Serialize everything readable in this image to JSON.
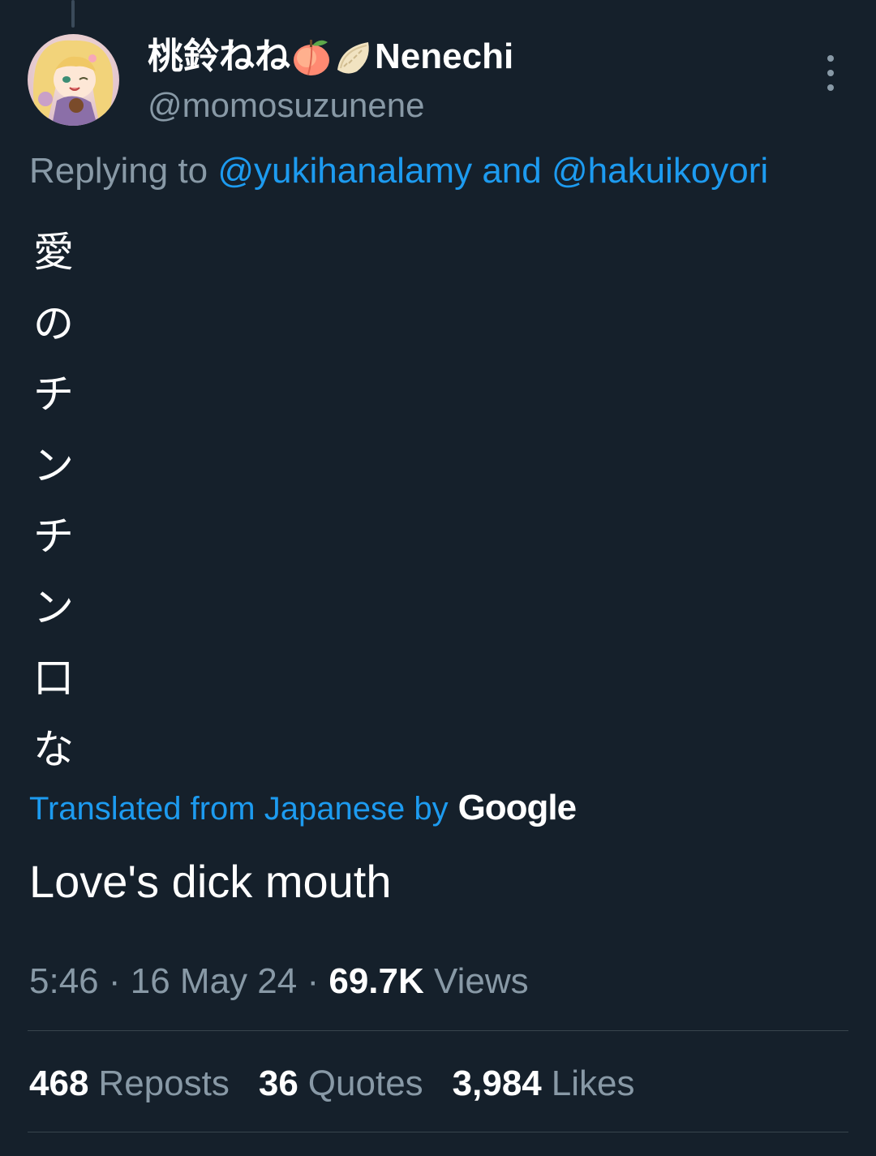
{
  "tweet": {
    "author": {
      "display_name": "桃鈴ねね",
      "display_name_suffix": "Nenechi",
      "name_emojis": [
        "peach-emoji",
        "gyoza-emoji"
      ],
      "handle": "@momosuzunene",
      "avatar": "anime-character-avatar"
    },
    "more_icon": "more-vertical-icon",
    "replying_to": {
      "prefix": "Replying to",
      "user1": "@yukihanalamy",
      "joiner": "and",
      "user2": "@hakuikoyori"
    },
    "text_chars": [
      "愛",
      "の",
      "チ",
      "ン",
      "チ",
      "ン",
      "口",
      "な"
    ],
    "translation_notice": "Translated from Japanese by",
    "translation_provider": "Google",
    "translation": "Love's dick mouth",
    "time": "5:46",
    "date": "16 May 24",
    "separator": "·",
    "views_count": "69.7K",
    "views_label": "Views",
    "stats": {
      "reposts_count": "468",
      "reposts_label": "Reposts",
      "quotes_count": "36",
      "quotes_label": "Quotes",
      "likes_count": "3,984",
      "likes_label": "Likes"
    },
    "colors": {
      "background": "#15202b",
      "link": "#1d9bf0",
      "secondary_text": "#8899a6",
      "divider": "#38444d"
    }
  }
}
